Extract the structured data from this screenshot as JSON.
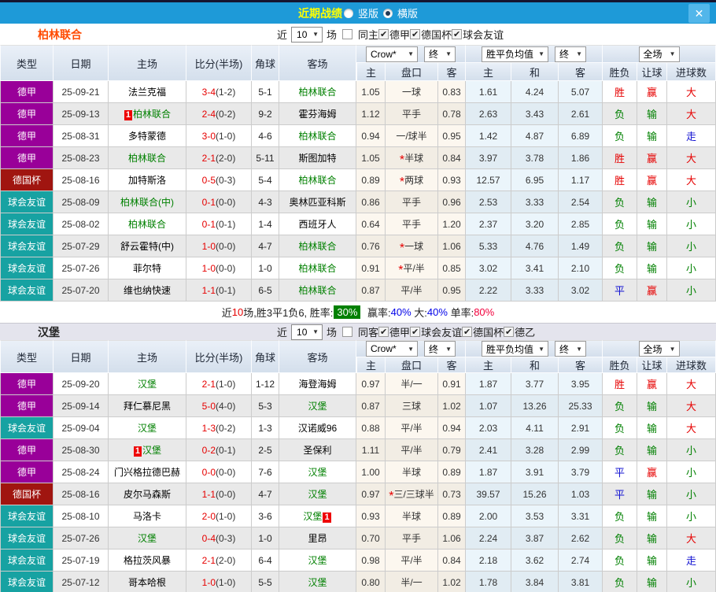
{
  "titlebar": {
    "title": "近期战绩",
    "vertical_label": "竖版",
    "horizontal_label": "横版",
    "selected": "横版",
    "close_label": "✕"
  },
  "columns": [
    "类型",
    "日期",
    "主场",
    "比分(半场)",
    "角球",
    "客场"
  ],
  "subcolumns": [
    "主",
    "盘口",
    "客",
    "主",
    "和",
    "客",
    "胜负",
    "让球",
    "进球数"
  ],
  "dropdowns": {
    "company": "Crow*",
    "final1": "终",
    "avg": "胜平负均值",
    "final2": "终",
    "scope": "全场"
  },
  "type_colors": {
    "德甲": "#990099",
    "德国杯": "#a01510",
    "球会友谊": "#17a2a2"
  },
  "sections": [
    {
      "team": "柏林联合",
      "filters": {
        "near": "近",
        "count": "10",
        "unit": "场",
        "same": "同主",
        "same_checked": false,
        "leagues": [
          "德甲",
          "德国杯",
          "球会友谊"
        ]
      },
      "rows": [
        {
          "type": "德甲",
          "date": "25-09-21",
          "home": {
            "name": "法兰克福",
            "focus": false,
            "badge": null
          },
          "score": "3-4",
          "half": "(1-2)",
          "corner": "5-1",
          "away": {
            "name": "柏林联合",
            "focus": true,
            "badge": null
          },
          "odds": [
            "1.05",
            "一球",
            "0.83"
          ],
          "star": false,
          "avg": [
            "1.61",
            "4.24",
            "5.07"
          ],
          "res": [
            [
              "胜",
              "r"
            ],
            [
              "赢",
              "r"
            ],
            [
              "大",
              "r"
            ]
          ]
        },
        {
          "type": "德甲",
          "date": "25-09-13",
          "home": {
            "name": "柏林联合",
            "focus": true,
            "badge": "before"
          },
          "score": "2-4",
          "half": "(0-2)",
          "corner": "9-2",
          "away": {
            "name": "霍芬海姆",
            "focus": false,
            "badge": null
          },
          "odds": [
            "1.12",
            "平手",
            "0.78"
          ],
          "star": false,
          "avg": [
            "2.63",
            "3.43",
            "2.61"
          ],
          "res": [
            [
              "负",
              "g"
            ],
            [
              "输",
              "g"
            ],
            [
              "大",
              "r"
            ]
          ]
        },
        {
          "type": "德甲",
          "date": "25-08-31",
          "home": {
            "name": "多特蒙德",
            "focus": false,
            "badge": null
          },
          "score": "3-0",
          "half": "(1-0)",
          "corner": "4-6",
          "away": {
            "name": "柏林联合",
            "focus": true,
            "badge": null
          },
          "odds": [
            "0.94",
            "一/球半",
            "0.95"
          ],
          "star": false,
          "avg": [
            "1.42",
            "4.87",
            "6.89"
          ],
          "res": [
            [
              "负",
              "g"
            ],
            [
              "输",
              "g"
            ],
            [
              "走",
              "b"
            ]
          ]
        },
        {
          "type": "德甲",
          "date": "25-08-23",
          "home": {
            "name": "柏林联合",
            "focus": true,
            "badge": null
          },
          "score": "2-1",
          "half": "(2-0)",
          "corner": "5-11",
          "away": {
            "name": "斯图加特",
            "focus": false,
            "badge": null
          },
          "odds": [
            "1.05",
            "半球",
            "0.84"
          ],
          "star": true,
          "avg": [
            "3.97",
            "3.78",
            "1.86"
          ],
          "res": [
            [
              "胜",
              "r"
            ],
            [
              "赢",
              "r"
            ],
            [
              "大",
              "r"
            ]
          ]
        },
        {
          "type": "德国杯",
          "date": "25-08-16",
          "home": {
            "name": "加特斯洛",
            "focus": false,
            "badge": null
          },
          "score": "0-5",
          "half": "(0-3)",
          "corner": "5-4",
          "away": {
            "name": "柏林联合",
            "focus": true,
            "badge": null
          },
          "odds": [
            "0.89",
            "两球",
            "0.93"
          ],
          "star": true,
          "avg": [
            "12.57",
            "6.95",
            "1.17"
          ],
          "res": [
            [
              "胜",
              "r"
            ],
            [
              "赢",
              "r"
            ],
            [
              "大",
              "r"
            ]
          ]
        },
        {
          "type": "球会友谊",
          "date": "25-08-09",
          "home": {
            "name": "柏林联合(中)",
            "focus": true,
            "badge": null
          },
          "score": "0-1",
          "half": "(0-0)",
          "corner": "4-3",
          "away": {
            "name": "奥林匹亚科斯",
            "focus": false,
            "badge": null
          },
          "odds": [
            "0.86",
            "平手",
            "0.96"
          ],
          "star": false,
          "avg": [
            "2.53",
            "3.33",
            "2.54"
          ],
          "res": [
            [
              "负",
              "g"
            ],
            [
              "输",
              "g"
            ],
            [
              "小",
              "g"
            ]
          ]
        },
        {
          "type": "球会友谊",
          "date": "25-08-02",
          "home": {
            "name": "柏林联合",
            "focus": true,
            "badge": null
          },
          "score": "0-1",
          "half": "(0-1)",
          "corner": "1-4",
          "away": {
            "name": "西班牙人",
            "focus": false,
            "badge": null
          },
          "odds": [
            "0.64",
            "平手",
            "1.20"
          ],
          "star": false,
          "avg": [
            "2.37",
            "3.20",
            "2.85"
          ],
          "res": [
            [
              "负",
              "g"
            ],
            [
              "输",
              "g"
            ],
            [
              "小",
              "g"
            ]
          ]
        },
        {
          "type": "球会友谊",
          "date": "25-07-29",
          "home": {
            "name": "舒云霍特(中)",
            "focus": false,
            "badge": null
          },
          "score": "1-0",
          "half": "(0-0)",
          "corner": "4-7",
          "away": {
            "name": "柏林联合",
            "focus": true,
            "badge": null
          },
          "odds": [
            "0.76",
            "一球",
            "1.06"
          ],
          "star": true,
          "avg": [
            "5.33",
            "4.76",
            "1.49"
          ],
          "res": [
            [
              "负",
              "g"
            ],
            [
              "输",
              "g"
            ],
            [
              "小",
              "g"
            ]
          ]
        },
        {
          "type": "球会友谊",
          "date": "25-07-26",
          "home": {
            "name": "菲尔特",
            "focus": false,
            "badge": null
          },
          "score": "1-0",
          "half": "(0-0)",
          "corner": "1-0",
          "away": {
            "name": "柏林联合",
            "focus": true,
            "badge": null
          },
          "odds": [
            "0.91",
            "平/半",
            "0.85"
          ],
          "star": true,
          "avg": [
            "3.02",
            "3.41",
            "2.10"
          ],
          "res": [
            [
              "负",
              "g"
            ],
            [
              "输",
              "g"
            ],
            [
              "小",
              "g"
            ]
          ]
        },
        {
          "type": "球会友谊",
          "date": "25-07-20",
          "home": {
            "name": "维也纳快速",
            "focus": false,
            "badge": null
          },
          "score": "1-1",
          "half": "(0-1)",
          "corner": "6-5",
          "away": {
            "name": "柏林联合",
            "focus": true,
            "badge": null
          },
          "odds": [
            "0.87",
            "平/半",
            "0.95"
          ],
          "star": false,
          "avg": [
            "2.22",
            "3.33",
            "3.02"
          ],
          "res": [
            [
              "平",
              "b"
            ],
            [
              "赢",
              "r"
            ],
            [
              "小",
              "g"
            ]
          ]
        }
      ],
      "summary": {
        "games_prefix": "近",
        "games": "10",
        "games_suffix": "场,胜3平1负6, 胜率:",
        "win_rate": "30%",
        "stats": [
          {
            "label": "赢率:",
            "value": "40%",
            "cls": "blue"
          },
          {
            "label": "大:",
            "value": "40%",
            "cls": "blue"
          },
          {
            "label": "单率:",
            "value": "80%",
            "cls": "pink"
          }
        ]
      }
    },
    {
      "team": "汉堡",
      "filters": {
        "near": "近",
        "count": "10",
        "unit": "场",
        "same": "同客",
        "same_checked": false,
        "leagues": [
          "德甲",
          "球会友谊",
          "德国杯",
          "德乙"
        ]
      },
      "rows": [
        {
          "type": "德甲",
          "date": "25-09-20",
          "home": {
            "name": "汉堡",
            "focus": true,
            "badge": null
          },
          "score": "2-1",
          "half": "(1-0)",
          "corner": "1-12",
          "away": {
            "name": "海登海姆",
            "focus": false,
            "badge": null
          },
          "odds": [
            "0.97",
            "半/一",
            "0.91"
          ],
          "star": false,
          "avg": [
            "1.87",
            "3.77",
            "3.95"
          ],
          "res": [
            [
              "胜",
              "r"
            ],
            [
              "赢",
              "r"
            ],
            [
              "大",
              "r"
            ]
          ]
        },
        {
          "type": "德甲",
          "date": "25-09-14",
          "home": {
            "name": "拜仁慕尼黑",
            "focus": false,
            "badge": null
          },
          "score": "5-0",
          "half": "(4-0)",
          "corner": "5-3",
          "away": {
            "name": "汉堡",
            "focus": true,
            "badge": null
          },
          "odds": [
            "0.87",
            "三球",
            "1.02"
          ],
          "star": false,
          "avg": [
            "1.07",
            "13.26",
            "25.33"
          ],
          "res": [
            [
              "负",
              "g"
            ],
            [
              "输",
              "g"
            ],
            [
              "大",
              "r"
            ]
          ]
        },
        {
          "type": "球会友谊",
          "date": "25-09-04",
          "home": {
            "name": "汉堡",
            "focus": true,
            "badge": null
          },
          "score": "1-3",
          "half": "(0-2)",
          "corner": "1-3",
          "away": {
            "name": "汉诺威96",
            "focus": false,
            "badge": null
          },
          "odds": [
            "0.88",
            "平/半",
            "0.94"
          ],
          "star": false,
          "avg": [
            "2.03",
            "4.11",
            "2.91"
          ],
          "res": [
            [
              "负",
              "g"
            ],
            [
              "输",
              "g"
            ],
            [
              "大",
              "r"
            ]
          ]
        },
        {
          "type": "德甲",
          "date": "25-08-30",
          "home": {
            "name": "汉堡",
            "focus": true,
            "badge": "before"
          },
          "score": "0-2",
          "half": "(0-1)",
          "corner": "2-5",
          "away": {
            "name": "圣保利",
            "focus": false,
            "badge": null
          },
          "odds": [
            "1.11",
            "平/半",
            "0.79"
          ],
          "star": false,
          "avg": [
            "2.41",
            "3.28",
            "2.99"
          ],
          "res": [
            [
              "负",
              "g"
            ],
            [
              "输",
              "g"
            ],
            [
              "小",
              "g"
            ]
          ]
        },
        {
          "type": "德甲",
          "date": "25-08-24",
          "home": {
            "name": "门兴格拉德巴赫",
            "focus": false,
            "badge": null
          },
          "score": "0-0",
          "half": "(0-0)",
          "corner": "7-6",
          "away": {
            "name": "汉堡",
            "focus": true,
            "badge": null
          },
          "odds": [
            "1.00",
            "半球",
            "0.89"
          ],
          "star": false,
          "avg": [
            "1.87",
            "3.91",
            "3.79"
          ],
          "res": [
            [
              "平",
              "b"
            ],
            [
              "赢",
              "r"
            ],
            [
              "小",
              "g"
            ]
          ]
        },
        {
          "type": "德国杯",
          "date": "25-08-16",
          "home": {
            "name": "皮尔马森斯",
            "focus": false,
            "badge": null
          },
          "score": "1-1",
          "half": "(0-0)",
          "corner": "4-7",
          "away": {
            "name": "汉堡",
            "focus": true,
            "badge": null
          },
          "odds": [
            "0.97",
            "三/三球半",
            "0.73"
          ],
          "star": true,
          "avg": [
            "39.57",
            "15.26",
            "1.03"
          ],
          "res": [
            [
              "平",
              "b"
            ],
            [
              "输",
              "g"
            ],
            [
              "小",
              "g"
            ]
          ]
        },
        {
          "type": "球会友谊",
          "date": "25-08-10",
          "home": {
            "name": "马洛卡",
            "focus": false,
            "badge": null
          },
          "score": "2-0",
          "half": "(1-0)",
          "corner": "3-6",
          "away": {
            "name": "汉堡",
            "focus": true,
            "badge": "after"
          },
          "odds": [
            "0.93",
            "半球",
            "0.89"
          ],
          "star": false,
          "avg": [
            "2.00",
            "3.53",
            "3.31"
          ],
          "res": [
            [
              "负",
              "g"
            ],
            [
              "输",
              "g"
            ],
            [
              "小",
              "g"
            ]
          ]
        },
        {
          "type": "球会友谊",
          "date": "25-07-26",
          "home": {
            "name": "汉堡",
            "focus": true,
            "badge": null
          },
          "score": "0-4",
          "half": "(0-3)",
          "corner": "1-0",
          "away": {
            "name": "里昂",
            "focus": false,
            "badge": null
          },
          "odds": [
            "0.70",
            "平手",
            "1.06"
          ],
          "star": false,
          "avg": [
            "2.24",
            "3.87",
            "2.62"
          ],
          "res": [
            [
              "负",
              "g"
            ],
            [
              "输",
              "g"
            ],
            [
              "大",
              "r"
            ]
          ]
        },
        {
          "type": "球会友谊",
          "date": "25-07-19",
          "home": {
            "name": "格拉茨风暴",
            "focus": false,
            "badge": null
          },
          "score": "2-1",
          "half": "(2-0)",
          "corner": "6-4",
          "away": {
            "name": "汉堡",
            "focus": true,
            "badge": null
          },
          "odds": [
            "0.98",
            "平/半",
            "0.84"
          ],
          "star": false,
          "avg": [
            "2.18",
            "3.62",
            "2.74"
          ],
          "res": [
            [
              "负",
              "g"
            ],
            [
              "输",
              "g"
            ],
            [
              "走",
              "b"
            ]
          ]
        },
        {
          "type": "球会友谊",
          "date": "25-07-12",
          "home": {
            "name": "哥本哈根",
            "focus": false,
            "badge": null
          },
          "score": "1-0",
          "half": "(1-0)",
          "corner": "5-5",
          "away": {
            "name": "汉堡",
            "focus": true,
            "badge": null
          },
          "odds": [
            "0.80",
            "半/一",
            "1.02"
          ],
          "star": false,
          "avg": [
            "1.78",
            "3.84",
            "3.81"
          ],
          "res": [
            [
              "负",
              "g"
            ],
            [
              "输",
              "g"
            ],
            [
              "小",
              "g"
            ]
          ]
        }
      ],
      "summary": null
    }
  ]
}
